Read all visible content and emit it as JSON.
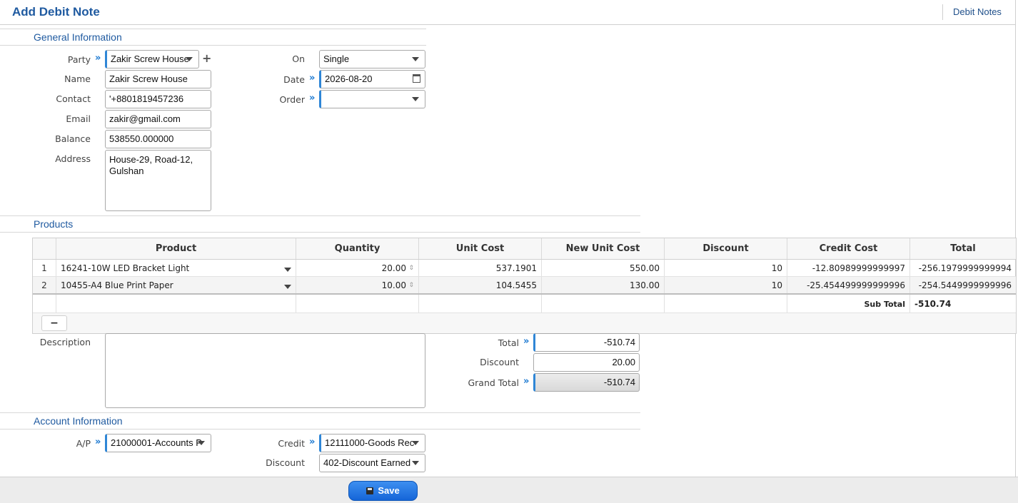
{
  "header": {
    "title": "Add Debit Note",
    "nav_link": "Debit Notes"
  },
  "general": {
    "section_title": "General Information",
    "labels": {
      "party": "Party",
      "name": "Name",
      "contact": "Contact",
      "email": "Email",
      "balance": "Balance",
      "address": "Address",
      "on": "On",
      "date": "Date",
      "order": "Order"
    },
    "values": {
      "party": "Zakir Screw House",
      "name": "Zakir Screw House",
      "contact": "'+8801819457236",
      "email": "zakir@gmail.com",
      "balance": "538550.000000",
      "address": "House-29, Road-12, Gulshan",
      "on": "Single",
      "date": "2026-08-20",
      "order": ""
    }
  },
  "products": {
    "section_title": "Products",
    "columns": [
      "Product",
      "Quantity",
      "Unit Cost",
      "New Unit Cost",
      "Discount",
      "Credit Cost",
      "Total"
    ],
    "rows": [
      {
        "idx": "1",
        "product": "16241-10W LED Bracket Light",
        "quantity": "20.00",
        "unit_cost": "537.1901",
        "new_unit_cost": "550.00",
        "discount": "10",
        "credit_cost": "-12.80989999999997",
        "total": "-256.1979999999994"
      },
      {
        "idx": "2",
        "product": "10455-A4 Blue Print Paper",
        "quantity": "10.00",
        "unit_cost": "104.5455",
        "new_unit_cost": "130.00",
        "discount": "10",
        "credit_cost": "-25.454499999999996",
        "total": "-254.5449999999996"
      }
    ],
    "subtotal_label": "Sub Total",
    "subtotal_value": "-510.74",
    "remove_label": "−"
  },
  "summary": {
    "description_label": "Description",
    "description_value": "",
    "total_label": "Total",
    "total_value": "-510.74",
    "discount_label": "Discount",
    "discount_value": "20.00",
    "grand_total_label": "Grand Total",
    "grand_total_value": "-510.74"
  },
  "account": {
    "section_title": "Account Information",
    "labels": {
      "ap": "A/P",
      "credit": "Credit",
      "discount": "Discount"
    },
    "values": {
      "ap": "21000001-Accounts P",
      "credit": "12111000-Goods Rec",
      "discount": "402-Discount Earned"
    }
  },
  "footer": {
    "save_label": "Save"
  },
  "colors": {
    "accent": "#1f5aa0",
    "required_marker": "#2f86d6",
    "save_button": "#1e6fe0"
  }
}
